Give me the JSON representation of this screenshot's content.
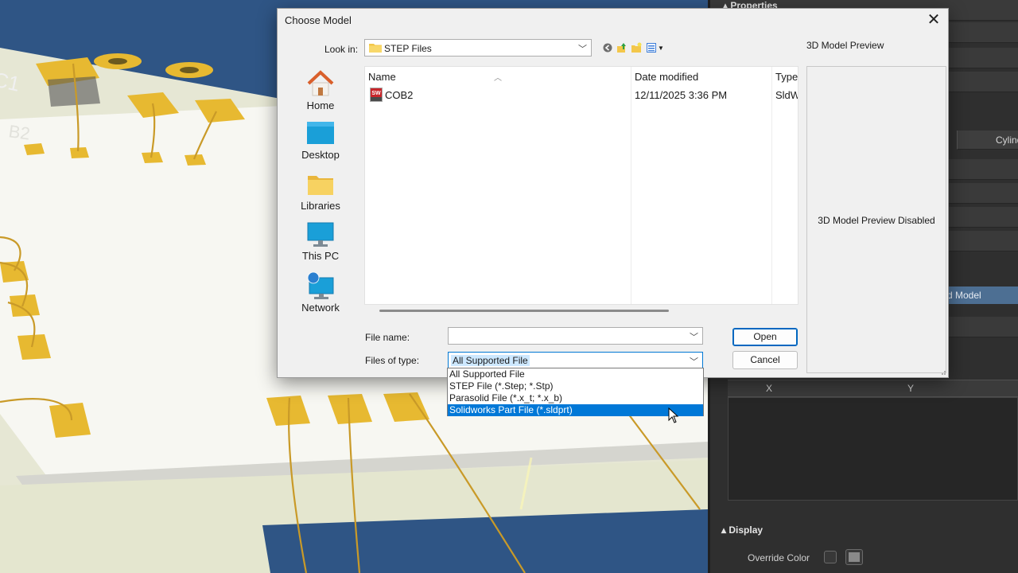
{
  "dialog": {
    "title": "Choose Model",
    "look_in_label": "Look in:",
    "look_in_value": "STEP Files",
    "preview_label": "3D Model Preview",
    "preview_message": "3D Model Preview Disabled",
    "places": [
      {
        "label": "Home",
        "icon": "home-icon"
      },
      {
        "label": "Desktop",
        "icon": "desktop-icon"
      },
      {
        "label": "Libraries",
        "icon": "libraries-icon"
      },
      {
        "label": "This PC",
        "icon": "this-pc-icon"
      },
      {
        "label": "Network",
        "icon": "network-icon"
      }
    ],
    "columns": [
      "Name",
      "Date modified",
      "Type"
    ],
    "files": [
      {
        "name": "COB2",
        "date_modified": "12/11/2025 3:36 PM",
        "type": "SldW",
        "icon": "solidworks-file-icon"
      }
    ],
    "file_name_label": "File name:",
    "file_name_value": "",
    "files_of_type_label": "Files of type:",
    "files_of_type_value": "All Supported File",
    "type_options": [
      "All Supported File",
      "STEP File (*.Step; *.Stp)",
      "Parasolid File (*.x_t; *.x_b)",
      "Solidworks Part File (*.sldprt)"
    ],
    "highlighted_option": "Solidworks Part File (*.sldprt)",
    "open_label": "Open",
    "cancel_label": "Cancel"
  },
  "properties_panel": {
    "title": "Properties",
    "cylinder_tab": "Cylind",
    "model_row_label": "d Model",
    "table_columns": [
      "X",
      "Y"
    ],
    "display_section": "Display",
    "override_color_label": "Override Color"
  },
  "colors": {
    "accent": "#0078d7",
    "pcb_blue": "#2f5585",
    "pad_gold": "#e7b931",
    "panel_dark": "#2f2f2f"
  }
}
